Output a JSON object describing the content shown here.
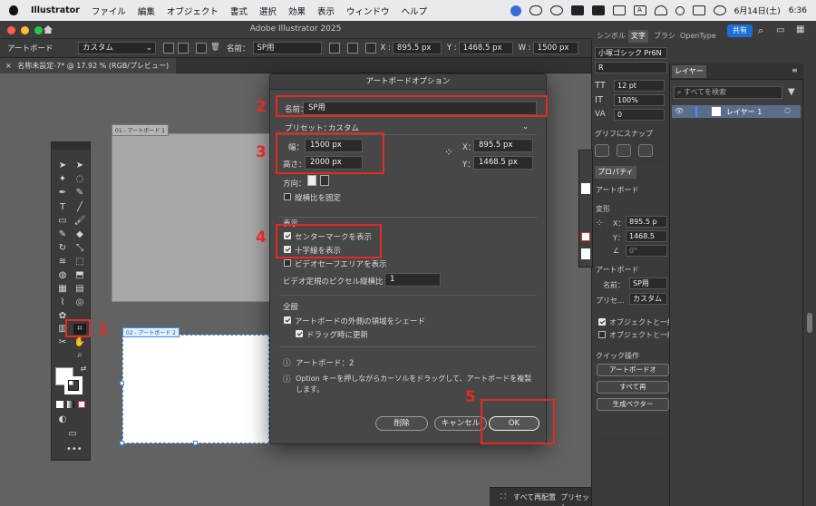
{
  "menubar": {
    "app": "Illustrator",
    "items": [
      "ファイル",
      "編集",
      "オブジェクト",
      "書式",
      "選択",
      "効果",
      "表示",
      "ウィンドウ",
      "ヘルプ"
    ],
    "date": "6月14日(土)",
    "time": "6:36",
    "input_method": "A"
  },
  "window": {
    "title": "Adobe Illustrator 2025"
  },
  "controlbar": {
    "artboard_label": "アートボード",
    "preset_value": "カスタム",
    "name_label": "名前：",
    "name_value": "SP用",
    "x_label": "X :",
    "x_value": "895.5 px",
    "y_label": "Y :",
    "y_value": "1468.5 px",
    "w_label": "W :",
    "w_value": "1500 px"
  },
  "document_tab": {
    "label": "名称未設定-7* @ 17.92 % (RGB/プレビュー)"
  },
  "artboards": [
    {
      "label": "01 - アートボード 1"
    },
    {
      "label": "02 - アートボード 2"
    }
  ],
  "dialog": {
    "title": "アートボードオプション",
    "name_label": "名前：",
    "name_value": "SP用",
    "preset_label": "プリセット：",
    "preset_value": "カスタム",
    "width_label": "幅：",
    "width_value": "1500 px",
    "height_label": "高さ：",
    "height_value": "2000 px",
    "x_label": "X：",
    "x_value": "895.5 px",
    "y_label": "Y：",
    "y_value": "1468.5 px",
    "orientation_label": "方向：",
    "constrain_label": "縦横比を固定",
    "display_section": "表示",
    "show_center_mark": "センターマークを表示",
    "show_cross_hairs": "十字線を表示",
    "show_video_safe": "ビデオセーフエリアを表示",
    "pixel_aspect_label": "ビデオ定規のピクセル縦横比：",
    "pixel_aspect_value": "1",
    "general_section": "全般",
    "fade_outside": "アートボードの外側の領域をシェード",
    "update_while_drag": "ドラッグ時に更新",
    "artboards_count": "アートボード：2",
    "info_text_1": "Option キーを押しながらカーソルをドラッグして、アートボードを複製",
    "info_text_2": "します。",
    "delete_button": "削除",
    "cancel_button": "キャンセル",
    "ok_button": "OK"
  },
  "annotations": {
    "n1": "1",
    "n2": "2",
    "n3": "3",
    "n4": "4",
    "n5": "5"
  },
  "right_panel": {
    "tabs": [
      "シンボル",
      "文字",
      "ブラシ",
      "OpenType"
    ],
    "share": "共有",
    "font_name": "小塚ゴシック Pr6N",
    "font_style": "R",
    "font_size": "12 pt",
    "scale": "100%",
    "tracking": "0",
    "glyph_snap": "グリフにスナップ",
    "properties_tab": "プロパティ",
    "prop_artboard": "アートボード",
    "transform": "変形",
    "tx_label": "X：",
    "tx_value": "895.5 p",
    "ty_label": "Y：",
    "ty_value": "1468.5",
    "angle_value": "0°",
    "prop_artboard2": "アートボード",
    "prop_name_label": "名前：",
    "prop_name_value": "SP用",
    "prop_preset_label": "プリセ...",
    "prop_preset_value": "カスタム",
    "move_with_artboard": "オブジェクトと一緒",
    "move_with_artboard2": "オブジェクトと一緒",
    "quick_actions": "クイック操作",
    "qa_artboard_options": "アートボードオ",
    "qa_rearrange_all": "すべて再",
    "qa_generate_vector": "生成ベクター"
  },
  "layers": {
    "tab": "レイヤー",
    "search_placeholder": "すべてを検索",
    "layer_name": "レイヤー 1"
  },
  "bottombar": {
    "rearrange": "すべて再配置",
    "preset": "プリセット"
  },
  "colors": {
    "annotation": "#e22b22",
    "selection": "#3a8de8",
    "share": "#1d6ed8"
  }
}
